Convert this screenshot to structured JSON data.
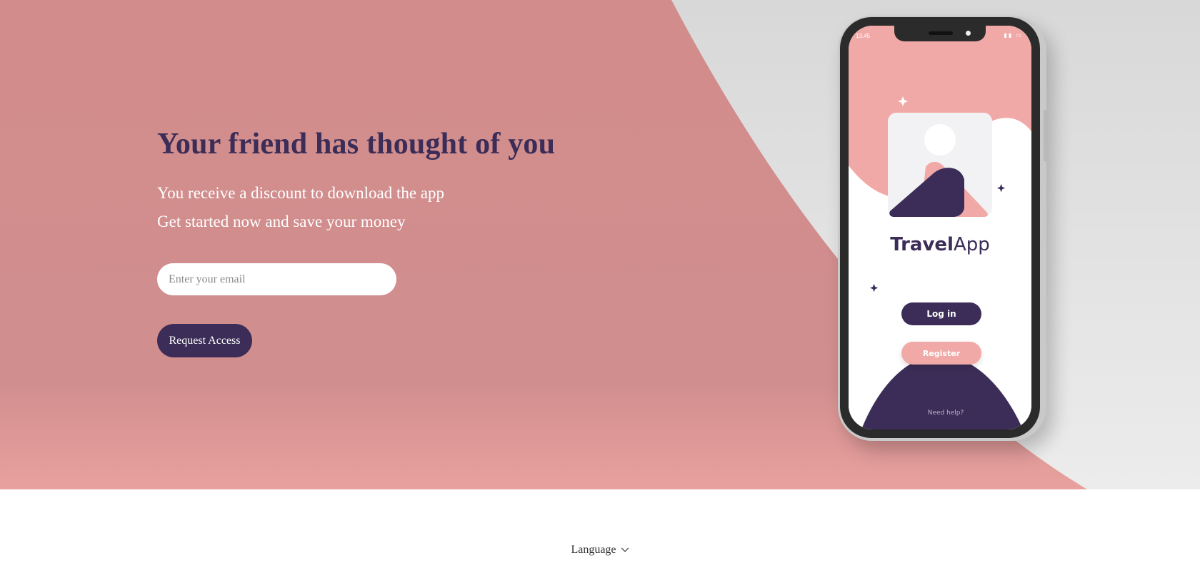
{
  "colors": {
    "brand_dark": "#3b2d57",
    "brand_pink": "#d28c8c",
    "pink_light": "#f1a9a7",
    "backdrop_gray": "#dcdcdc"
  },
  "hero": {
    "headline": "Your friend has thought of you",
    "subline_1": "You receive a discount to download the app",
    "subline_2": "Get started now and save your money",
    "email_placeholder": "Enter your email",
    "cta_label": "Request Access"
  },
  "phone": {
    "status_time": "13.45",
    "app_name_bold": "Travel",
    "app_name_light": "App",
    "login_label": "Log in",
    "register_label": "Register",
    "help_text": "Need help?"
  },
  "footer": {
    "language_label": "Language",
    "language_icon": "chevron-down-icon"
  }
}
